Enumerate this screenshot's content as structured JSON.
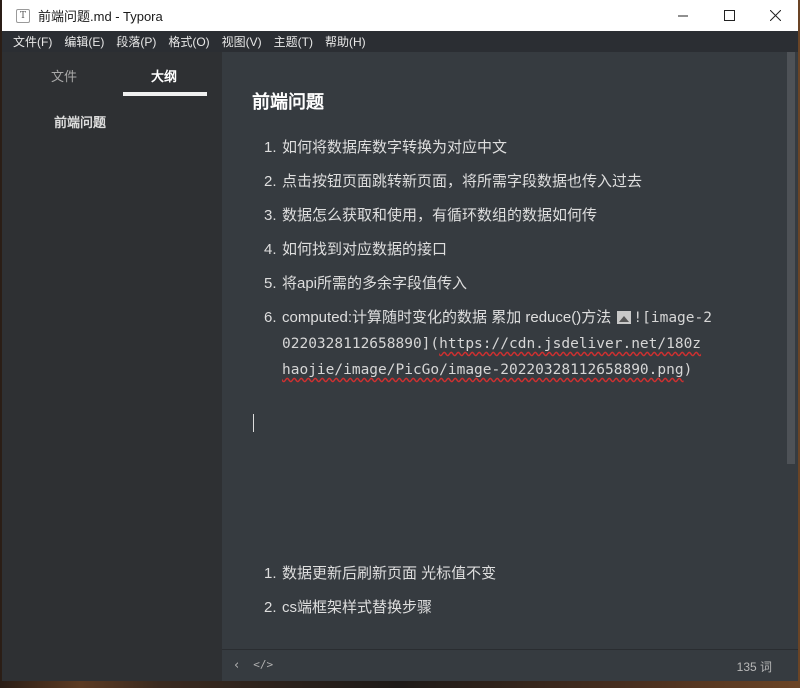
{
  "window": {
    "app_icon": "T",
    "title": "前端问题.md - Typora"
  },
  "menu": [
    "文件(F)",
    "编辑(E)",
    "段落(P)",
    "格式(O)",
    "视图(V)",
    "主题(T)",
    "帮助(H)"
  ],
  "sidebar": {
    "tabs": [
      "文件",
      "大纲"
    ],
    "active_tab": "大纲",
    "outline_items": [
      "前端问题"
    ]
  },
  "document": {
    "title": "前端问题",
    "list1": [
      "如何将数据库数字转换为对应中文",
      "点击按钮页面跳转新页面，将所需字段数据也传入过去",
      "数据怎么获取和使用，有循环数组的数据如何传",
      "如何找到对应数据的接口",
      "将api所需的多余字段值传入"
    ],
    "item6": {
      "text": "computed:计算随时变化的数据 累加  reduce()方法 ",
      "md_open": "![image-2",
      "md_line2a": "0220328112658890](",
      "url_part1": "https://cdn.jsdeliver.net/180z",
      "url_part2": "haojie/image/PicGo/image-20220328112658890.png",
      "md_close": ")"
    },
    "list2": [
      "数据更新后刷新页面 光标值不变",
      "cs端框架样式替换步骤"
    ]
  },
  "footer": {
    "back_icon": "‹",
    "source_icon": "</>",
    "word_count": "135 词"
  }
}
